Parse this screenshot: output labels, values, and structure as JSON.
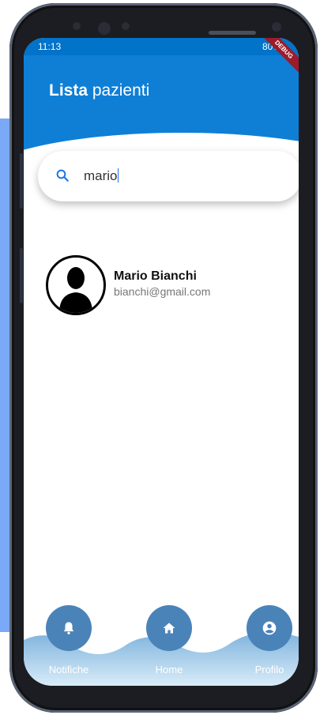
{
  "status_bar": {
    "time": "11:13",
    "right_text": "80%",
    "debug_label": "DEBUG"
  },
  "header": {
    "title_bold": "Lista",
    "title_rest": "pazienti"
  },
  "search": {
    "value": "mario",
    "icon": "search-icon"
  },
  "patients": [
    {
      "name": "Mario Bianchi",
      "email": "bianchi@gmail.com",
      "avatar": "person-silhouette"
    }
  ],
  "bottom_nav": {
    "items": [
      {
        "label": "Notifiche",
        "icon": "bell-icon"
      },
      {
        "label": "Home",
        "icon": "home-icon"
      },
      {
        "label": "Profilo",
        "icon": "account-circle-icon"
      }
    ]
  },
  "colors": {
    "header": "#0f7fd6",
    "nav_button": "#4a83b8",
    "nav_wave": "#a9cde9"
  }
}
